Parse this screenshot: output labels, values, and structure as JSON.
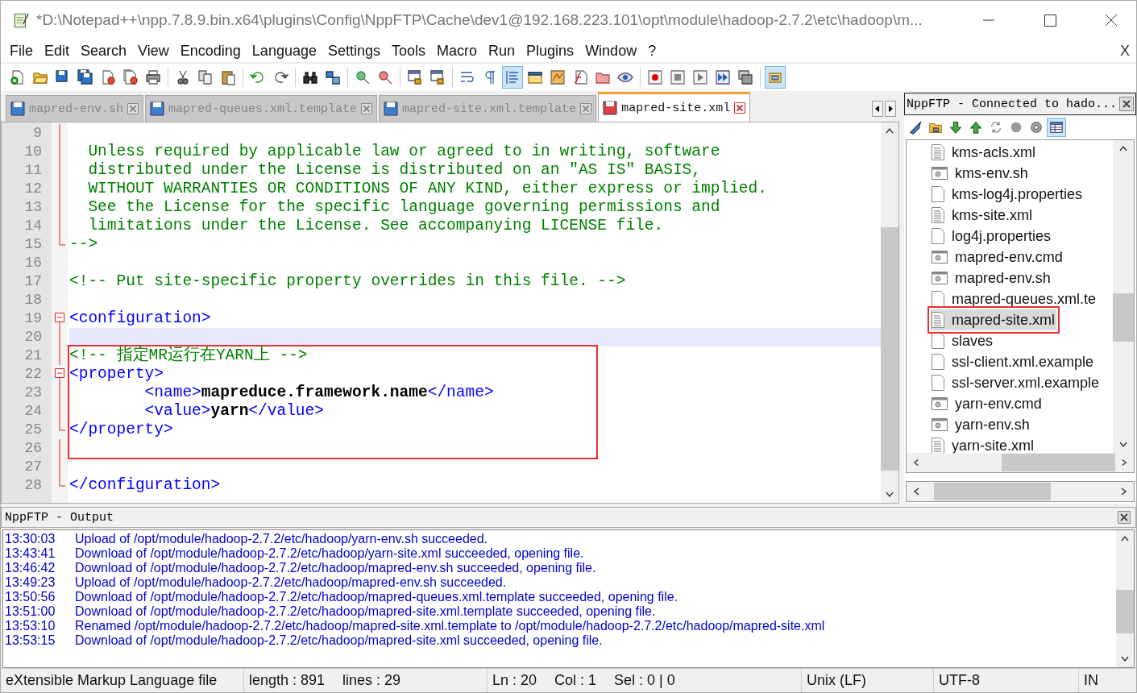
{
  "window": {
    "title": "*D:\\Notepad++\\npp.7.8.9.bin.x64\\plugins\\Config\\NppFTP\\Cache\\dev1@192.168.223.101\\opt\\module\\hadoop-2.7.2\\etc\\hadoop\\m..."
  },
  "menu": {
    "items": [
      "File",
      "Edit",
      "Search",
      "View",
      "Encoding",
      "Language",
      "Settings",
      "Tools",
      "Macro",
      "Run",
      "Plugins",
      "Window",
      "?"
    ],
    "close": "X"
  },
  "toolbar": [
    [
      {
        "kind": "new",
        "pressed": false
      },
      {
        "kind": "open",
        "pressed": false
      },
      {
        "kind": "save",
        "pressed": false
      },
      {
        "kind": "saveall",
        "pressed": false
      },
      {
        "kind": "close",
        "pressed": false
      },
      {
        "kind": "closeall",
        "pressed": false
      },
      {
        "kind": "print",
        "pressed": false
      }
    ],
    [
      {
        "kind": "cut",
        "pressed": false
      },
      {
        "kind": "copy",
        "pressed": false
      },
      {
        "kind": "paste",
        "pressed": false
      }
    ],
    [
      {
        "kind": "undo",
        "pressed": false
      },
      {
        "kind": "redo",
        "pressed": false
      }
    ],
    [
      {
        "kind": "find",
        "pressed": false
      },
      {
        "kind": "replace",
        "pressed": false
      }
    ],
    [
      {
        "kind": "zoomin",
        "pressed": false
      },
      {
        "kind": "zoomout",
        "pressed": false
      }
    ],
    [
      {
        "kind": "syncv",
        "pressed": false
      },
      {
        "kind": "synch",
        "pressed": false
      }
    ],
    [
      {
        "kind": "wrap",
        "pressed": false
      },
      {
        "kind": "allchars",
        "pressed": false
      },
      {
        "kind": "indent",
        "pressed": true
      },
      {
        "kind": "udl",
        "pressed": false
      },
      {
        "kind": "docmap",
        "pressed": false
      },
      {
        "kind": "funclist",
        "pressed": false
      },
      {
        "kind": "workspace",
        "pressed": false
      },
      {
        "kind": "monitor",
        "pressed": false
      }
    ],
    [
      {
        "kind": "record",
        "pressed": false
      },
      {
        "kind": "stop",
        "pressed": false
      },
      {
        "kind": "play",
        "pressed": false
      },
      {
        "kind": "playmulti",
        "pressed": false
      },
      {
        "kind": "savemacro",
        "pressed": false
      }
    ],
    [
      {
        "kind": "panel",
        "pressed": true
      }
    ]
  ],
  "tabs": [
    {
      "label": "mapred-env.sh",
      "selected": false,
      "modified": false
    },
    {
      "label": "mapred-queues.xml.template",
      "selected": false,
      "modified": false
    },
    {
      "label": "mapred-site.xml.template",
      "selected": false,
      "modified": false
    },
    {
      "label": "mapred-site.xml",
      "selected": true,
      "modified": true
    }
  ],
  "editor": {
    "lines_above": [
      {
        "number": "9",
        "kind": "fold_body",
        "current": false
      },
      {
        "number": "10",
        "kind": "fold_body",
        "current": false,
        "segments": [
          {
            "kind": "comment",
            "text": "  Unless required by applicable law or agreed to in writing, software"
          }
        ]
      },
      {
        "number": "11",
        "kind": "fold_body",
        "current": false,
        "segments": [
          {
            "kind": "comment",
            "text": "  distributed under the License is distributed on an \"AS IS\" BASIS,"
          }
        ]
      },
      {
        "number": "12",
        "kind": "fold_body",
        "current": false,
        "segments": [
          {
            "kind": "comment",
            "text": "  WITHOUT WARRANTIES OR CONDITIONS OF ANY KIND, either express or implied."
          }
        ]
      },
      {
        "number": "13",
        "kind": "fold_body",
        "current": false,
        "segments": [
          {
            "kind": "comment",
            "text": "  See the License for the specific language governing permissions and"
          }
        ]
      },
      {
        "number": "14",
        "kind": "fold_body",
        "current": false,
        "segments": [
          {
            "kind": "comment",
            "text": "  limitations under the License. See accompanying LICENSE file."
          }
        ]
      },
      {
        "number": "15",
        "kind": "fold_end",
        "current": false,
        "segments": [
          {
            "kind": "comment",
            "text": "-->"
          }
        ]
      },
      {
        "number": "16",
        "kind": "plain",
        "current": false
      },
      {
        "number": "17",
        "kind": "plain",
        "current": false,
        "segments": [
          {
            "kind": "comment",
            "text": "<!-- Put site-specific property overrides in this file. -->"
          }
        ]
      },
      {
        "number": "18",
        "kind": "plain",
        "current": false
      },
      {
        "number": "19",
        "kind": "fold_start",
        "current": false,
        "segments": [
          {
            "kind": "tag",
            "text": "<configuration>"
          }
        ]
      },
      {
        "number": "20",
        "kind": "fold_body",
        "current": true
      }
    ],
    "boxed_lines": [
      {
        "number": "21",
        "kind": "fold_body",
        "current": false,
        "segments": [
          {
            "kind": "comment",
            "text": "<!-- 指定MR运行在YARN上 -->"
          }
        ]
      },
      {
        "number": "22",
        "kind": "fold_start",
        "current": false,
        "segments": [
          {
            "kind": "tag",
            "text": "<property>"
          }
        ]
      },
      {
        "number": "23",
        "kind": "fold_body",
        "current": false,
        "segments": [
          {
            "kind": "tag",
            "text": "        <name>"
          },
          {
            "kind": "value",
            "text": "mapreduce.framework.name"
          },
          {
            "kind": "tag",
            "text": "</name>"
          }
        ]
      },
      {
        "number": "24",
        "kind": "fold_body",
        "current": false,
        "segments": [
          {
            "kind": "tag",
            "text": "        <value>"
          },
          {
            "kind": "value",
            "text": "yarn"
          },
          {
            "kind": "tag",
            "text": "</value>"
          }
        ]
      },
      {
        "number": "25",
        "kind": "fold_end",
        "current": false,
        "segments": [
          {
            "kind": "tag",
            "text": "</property>"
          }
        ]
      },
      {
        "number": "26",
        "kind": "fold_body",
        "current": false
      }
    ],
    "lines_below": [
      {
        "number": "27",
        "kind": "fold_body",
        "current": false
      },
      {
        "number": "28",
        "kind": "fold_end",
        "current": false,
        "segments": [
          {
            "kind": "tag",
            "text": "</configuration>"
          }
        ]
      }
    ]
  },
  "ftp_panel": {
    "title": "NppFTP - Connected to hado...",
    "toolbar": [
      {
        "kind": "connect",
        "pressed": false
      },
      {
        "kind": "folder",
        "pressed": false
      },
      {
        "kind": "download",
        "pressed": false
      },
      {
        "kind": "upload",
        "pressed": false
      },
      {
        "kind": "refresh",
        "pressed": false
      },
      {
        "kind": "abort",
        "pressed": false
      },
      {
        "kind": "settings",
        "pressed": false
      },
      {
        "kind": "messages",
        "pressed": true
      }
    ],
    "files": [
      {
        "name": "kms-acls.xml",
        "kind": "xml",
        "selected": false,
        "marked": false
      },
      {
        "name": "kms-env.sh",
        "kind": "script",
        "selected": false,
        "marked": false
      },
      {
        "name": "kms-log4j.properties",
        "kind": "file",
        "selected": false,
        "marked": false
      },
      {
        "name": "kms-site.xml",
        "kind": "xml",
        "selected": false,
        "marked": false
      },
      {
        "name": "log4j.properties",
        "kind": "file",
        "selected": false,
        "marked": false
      },
      {
        "name": "mapred-env.cmd",
        "kind": "script",
        "selected": false,
        "marked": false
      },
      {
        "name": "mapred-env.sh",
        "kind": "script",
        "selected": false,
        "marked": false
      },
      {
        "name": "mapred-queues.xml.te",
        "kind": "file",
        "selected": false,
        "marked": false
      },
      {
        "name": "mapred-site.xml",
        "kind": "xml",
        "selected": true,
        "marked": true
      },
      {
        "name": "slaves",
        "kind": "file",
        "selected": false,
        "marked": false
      },
      {
        "name": "ssl-client.xml.example",
        "kind": "file",
        "selected": false,
        "marked": false
      },
      {
        "name": "ssl-server.xml.example",
        "kind": "file",
        "selected": false,
        "marked": false
      },
      {
        "name": "yarn-env.cmd",
        "kind": "script",
        "selected": false,
        "marked": false
      },
      {
        "name": "yarn-env.sh",
        "kind": "script",
        "selected": false,
        "marked": false
      },
      {
        "name": "yarn-site.xml",
        "kind": "xml",
        "selected": false,
        "marked": false
      }
    ]
  },
  "output": {
    "title": "NppFTP - Output",
    "entries": [
      {
        "time": "13:30:03",
        "message": "Upload of /opt/module/hadoop-2.7.2/etc/hadoop/yarn-env.sh succeeded."
      },
      {
        "time": "13:43:41",
        "message": "Download of /opt/module/hadoop-2.7.2/etc/hadoop/yarn-site.xml succeeded, opening file."
      },
      {
        "time": "13:46:42",
        "message": "Download of /opt/module/hadoop-2.7.2/etc/hadoop/mapred-env.sh succeeded, opening file."
      },
      {
        "time": "13:49:23",
        "message": "Upload of /opt/module/hadoop-2.7.2/etc/hadoop/mapred-env.sh succeeded."
      },
      {
        "time": "13:50:56",
        "message": "Download of /opt/module/hadoop-2.7.2/etc/hadoop/mapred-queues.xml.template succeeded, opening file."
      },
      {
        "time": "13:51:00",
        "message": "Download of /opt/module/hadoop-2.7.2/etc/hadoop/mapred-site.xml.template succeeded, opening file."
      },
      {
        "time": "13:53:10",
        "message": "Renamed /opt/module/hadoop-2.7.2/etc/hadoop/mapred-site.xml.template to /opt/module/hadoop-2.7.2/etc/hadoop/mapred-site.xml"
      },
      {
        "time": "13:53:15",
        "message": "Download of /opt/module/hadoop-2.7.2/etc/hadoop/mapred-site.xml succeeded, opening file."
      }
    ]
  },
  "status_bar": [
    [
      "eXtensible Markup Language file"
    ],
    [
      "length : 891",
      "lines : 29"
    ],
    [
      "Ln : 20",
      "Col : 1",
      "Sel : 0 | 0"
    ],
    [
      "Unix (LF)"
    ],
    [
      "UTF-8"
    ],
    [
      "IN"
    ]
  ]
}
